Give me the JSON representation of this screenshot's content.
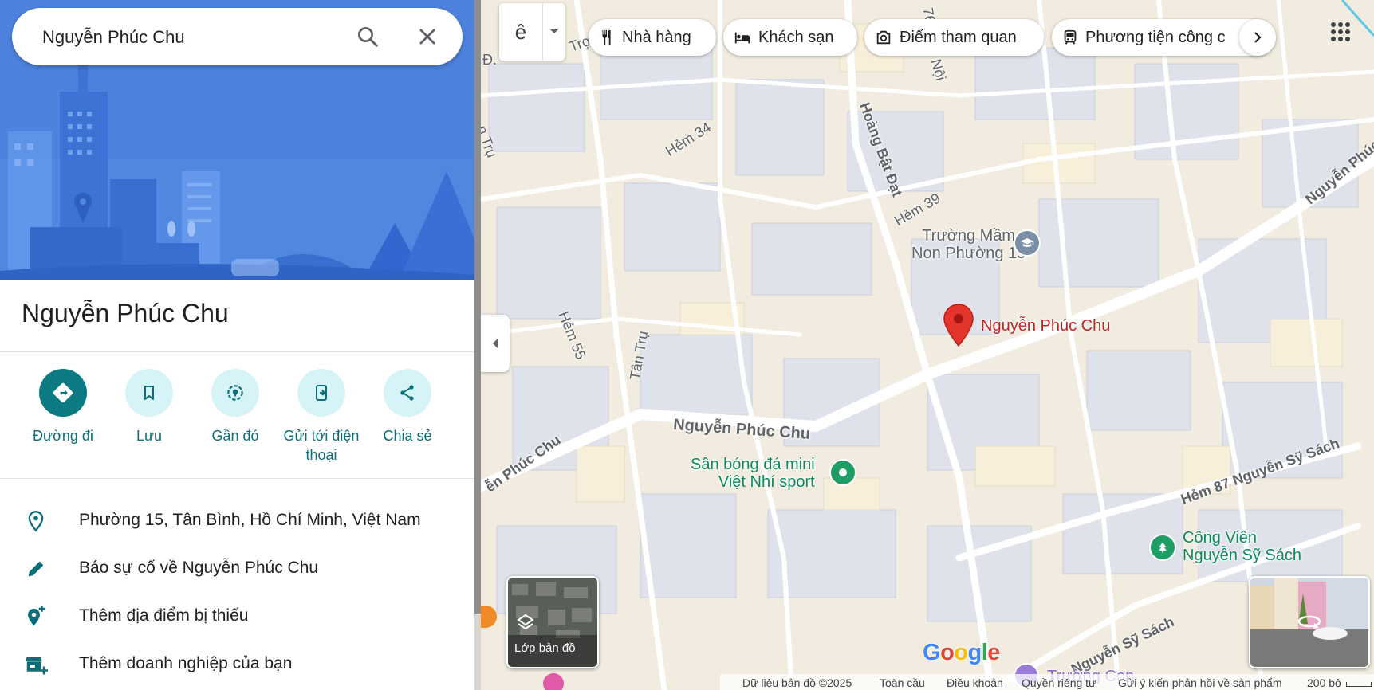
{
  "search": {
    "value": "Nguyễn Phúc Chu",
    "search_icon": "search-icon",
    "close_icon": "close-icon"
  },
  "place": {
    "title": "Nguyễn Phúc Chu"
  },
  "actions": [
    {
      "label": "Đường đi",
      "icon": "directions-icon"
    },
    {
      "label": "Lưu",
      "icon": "bookmark-icon"
    },
    {
      "label": "Gần đó",
      "icon": "nearby-icon"
    },
    {
      "label": "Gửi tới điện thoại",
      "icon": "send-to-phone-icon"
    },
    {
      "label": "Chia sẻ",
      "icon": "share-icon"
    }
  ],
  "info": [
    {
      "text": "Phường 15, Tân Bình, Hồ Chí Minh, Việt Nam",
      "icon": "location-pin-icon"
    },
    {
      "text": "Báo sự cố về Nguyễn Phúc Chu",
      "icon": "pencil-icon"
    },
    {
      "text": "Thêm địa điểm bị thiếu",
      "icon": "add-place-icon"
    },
    {
      "text": "Thêm doanh nghiệp của bạn",
      "icon": "add-business-icon"
    }
  ],
  "map": {
    "ime_label": "ê",
    "chips": [
      "Nhà hàng",
      "Khách sạn",
      "Điểm tham quan",
      "Phương tiện công c"
    ],
    "streets": [
      "Hẻm 34",
      "Hoàng Bật Đạt",
      "Hẻm 39",
      "Hẻm 55",
      "Tân Trụ",
      "Nguyễn Phúc Chu",
      "ễn Phúc Chu",
      "Hẻm 87 Nguyễn Sỹ Sách",
      "Nguyễn Sỹ Sách",
      "Nguyễn Phúc",
      "n Trụ",
      "Trợ",
      "Đ. ",
      "5",
      "Nội",
      "76"
    ],
    "pois": [
      {
        "name_line1": "Trường Mầm",
        "name_line2": "Non Phường 15",
        "type": "school-icon"
      },
      {
        "name_line1": "Nguyễn Phúc Chu",
        "name_line2": "",
        "type": "red-pin-icon"
      },
      {
        "name_line1": "Sân bóng đá mini",
        "name_line2": "Việt Nhí sport",
        "type": "sports-icon"
      },
      {
        "name_line1": "Công Viên",
        "name_line2": "Nguyễn Sỹ Sách",
        "type": "park-icon"
      },
      {
        "name_line1": "Trường Con",
        "name_line2": "",
        "type": "school-icon"
      }
    ],
    "layers_label": "Lớp bản đồ",
    "google_logo": "Google",
    "footer": [
      "Dữ liệu bản đồ ©2025",
      "Toàn cầu",
      "Điều khoản",
      "Quyền riêng tư",
      "Gửi ý kiến phản hồi về sản phẩm",
      "200 bộ"
    ]
  },
  "colors": {
    "teal": "#0b7a83",
    "chip_bg": "#d6f3f8",
    "pin_red": "#e3352b",
    "poi_green": "#0d8a5a",
    "hero_blue": "#4f86e0"
  }
}
